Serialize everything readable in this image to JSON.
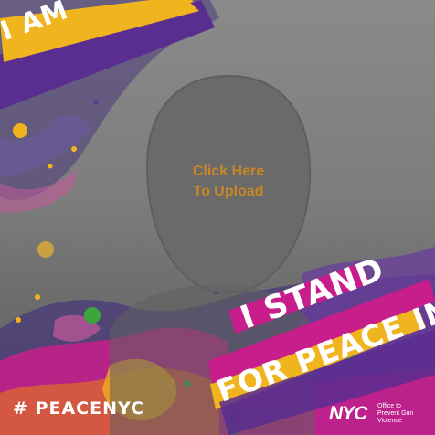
{
  "upload": {
    "line1": "Click Here",
    "line2": "To Upload"
  },
  "banners": {
    "top_left": "I AM",
    "bottom_line1": "I STAND",
    "bottom_line2": "FOR PEACE IN"
  },
  "hashtag": "# PEACENYC",
  "logo": {
    "mark": "NYC",
    "office_line1": "Office to",
    "office_line2": "Prevent Gun",
    "office_line3": "Violence"
  },
  "colors": {
    "upload_text": "#c88724",
    "purple": "#5a2d91",
    "magenta": "#c81e8c",
    "yellow": "#f0b41e",
    "orange": "#e06e23",
    "green": "#3ca53c"
  }
}
